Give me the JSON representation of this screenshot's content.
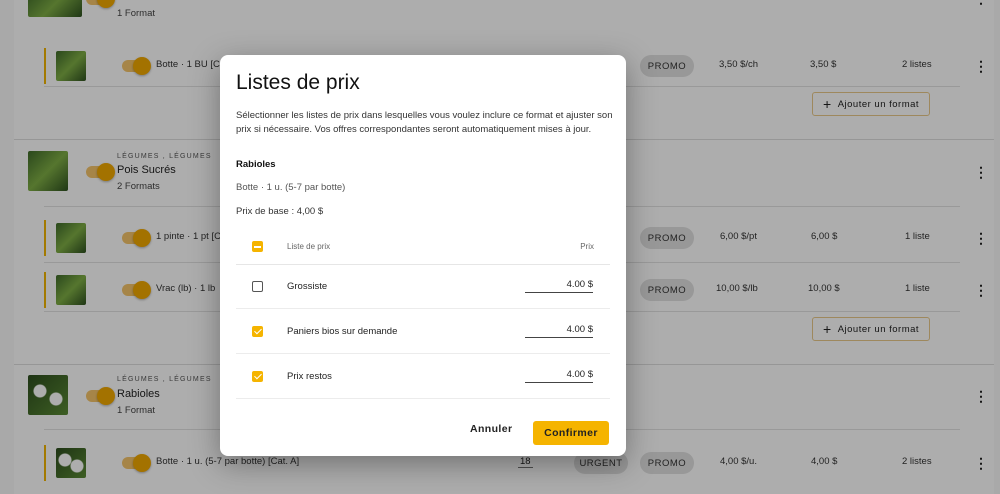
{
  "products": [
    {
      "formats_count": "1 Format",
      "format_rows": [
        {
          "label": "Botte · 1 BU [Ca",
          "promo": "PROMO",
          "unit_price": "3,50 $/ch",
          "price": "3,50 $",
          "lists": "2 listes"
        }
      ],
      "add_format_label": "Ajouter un format"
    },
    {
      "category": "LÉGUMES , LÉGUMES",
      "name": "Pois Sucrés",
      "formats_count": "2 Formats",
      "format_rows": [
        {
          "label": "1 pinte · 1 pt [C",
          "promo": "PROMO",
          "unit_price": "6,00 $/pt",
          "price": "6,00 $",
          "lists": "1 liste"
        },
        {
          "label": "Vrac (lb) · 1 lb",
          "promo": "PROMO",
          "unit_price": "10,00 $/lb",
          "price": "10,00 $",
          "lists": "1 liste"
        }
      ],
      "add_format_label": "Ajouter un format"
    },
    {
      "category": "LÉGUMES , LÉGUMES",
      "name": "Rabioles",
      "formats_count": "1 Format",
      "format_rows": [
        {
          "label": "Botte · 1 u. (5-7 par botte) [Cat. A]",
          "qty": "18",
          "urgent": "URGENT",
          "promo": "PROMO",
          "unit_price": "4,00 $/u.",
          "price": "4,00 $",
          "lists": "2 listes"
        }
      ]
    }
  ],
  "modal": {
    "title": "Listes de prix",
    "description": "Sélectionner les listes de prix dans lesquelles vous voulez inclure ce format et ajuster son prix si nécessaire. Vos offres correspondantes seront automatiquement mises à jour.",
    "product": "Rabioles",
    "format": "Botte · 1 u. (5-7 par botte)",
    "base_price": "Prix de base : 4,00 $",
    "col_list": "Liste de prix",
    "col_price": "Prix",
    "rows": [
      {
        "name": "Grossiste",
        "checked": false,
        "price": "4.00 $"
      },
      {
        "name": "Paniers bios sur demande",
        "checked": true,
        "price": "4.00 $"
      },
      {
        "name": "Prix restos",
        "checked": true,
        "price": "4.00 $"
      }
    ],
    "cancel_label": "Annuler",
    "confirm_label": "Confirmer"
  },
  "colors": {
    "accent": "#f5b400",
    "overlay": "rgba(0,0,0,0.32)"
  },
  "icons": {
    "more": "more-vert-icon",
    "add": "plus-icon"
  }
}
